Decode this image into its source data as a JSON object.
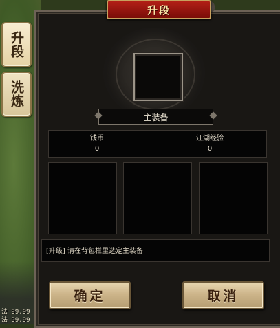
{
  "window": {
    "title": "升段"
  },
  "side_tabs": [
    {
      "label": "升段",
      "active": true
    },
    {
      "label": "洗炼",
      "active": false
    }
  ],
  "player_stats": [
    {
      "label": "法 99.99"
    },
    {
      "label": "法 99.99"
    }
  ],
  "main": {
    "slot_label": "主装备",
    "stats": [
      {
        "label": "钱币",
        "value": "0"
      },
      {
        "label": "江湖经验",
        "value": "0"
      }
    ],
    "message": "[升级] 请在背包栏里选定主装备"
  },
  "buttons": {
    "confirm": "确定",
    "cancel": "取消"
  },
  "colors": {
    "title_bg": "#9a1610",
    "title_text": "#f8e6a8",
    "button_bg": "#cdb58a",
    "panel_bg": "#191714"
  }
}
